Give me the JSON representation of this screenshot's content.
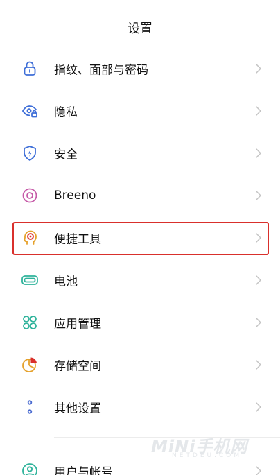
{
  "header": {
    "title": "设置"
  },
  "settings": {
    "items": [
      {
        "label": "指纹、面部与密码",
        "icon": "lock-icon",
        "color": "#3f6fd8"
      },
      {
        "label": "隐私",
        "icon": "eye-privacy-icon",
        "color": "#3f6fd8"
      },
      {
        "label": "安全",
        "icon": "shield-icon",
        "color": "#3f6fd8"
      },
      {
        "label": "Breeno",
        "icon": "breeno-icon",
        "color": "#c65aa8"
      },
      {
        "label": "便捷工具",
        "icon": "convenience-tools-icon",
        "color": "#e5a12b"
      },
      {
        "label": "电池",
        "icon": "battery-icon",
        "color": "#2fb39b"
      },
      {
        "label": "应用管理",
        "icon": "apps-grid-icon",
        "color": "#2fb39b"
      },
      {
        "label": "存储空间",
        "icon": "storage-pie-icon",
        "color": "#e5a12b"
      },
      {
        "label": "其他设置",
        "icon": "more-dots-icon",
        "color": "#4a6bd0"
      },
      {
        "label": "用户与帐号",
        "icon": "user-icon",
        "color": "#2fb39b"
      }
    ]
  },
  "highlight": {
    "color": "#d9302c",
    "target": "便捷工具"
  },
  "watermark": {
    "main": "MiNi手机网",
    "sub": "NETDEU.COM"
  }
}
